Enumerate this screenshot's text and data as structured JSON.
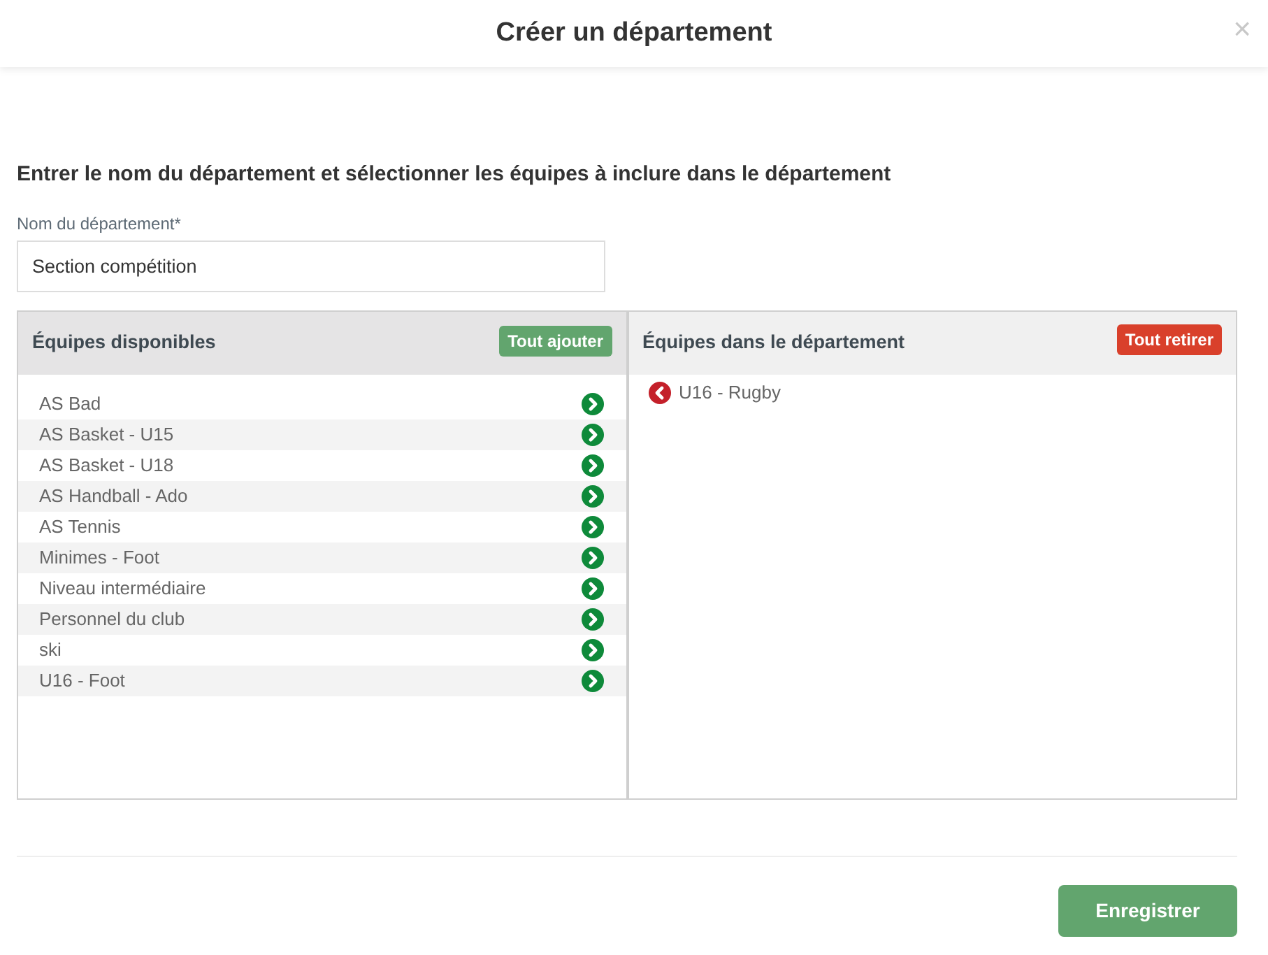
{
  "dialog": {
    "title": "Créer un département",
    "close": "×"
  },
  "instruction": "Entrer le nom du département et sélectionner les équipes à inclure dans le département",
  "name_field": {
    "label": "Nom du département*",
    "value": "Section compétition"
  },
  "available": {
    "title": "Équipes disponibles",
    "action": "Tout ajouter",
    "items": [
      {
        "label": "AS Bad"
      },
      {
        "label": "AS Basket - U15"
      },
      {
        "label": "AS Basket - U18"
      },
      {
        "label": "AS Handball - Ado"
      },
      {
        "label": "AS Tennis"
      },
      {
        "label": "Minimes - Foot"
      },
      {
        "label": "Niveau intermédiaire"
      },
      {
        "label": "Personnel du club"
      },
      {
        "label": "ski"
      },
      {
        "label": "U16 - Foot"
      }
    ]
  },
  "included": {
    "title": "Équipes dans le département",
    "action": "Tout retirer",
    "items": [
      {
        "label": "U16 - Rugby"
      }
    ]
  },
  "save_button": "Enregistrer"
}
